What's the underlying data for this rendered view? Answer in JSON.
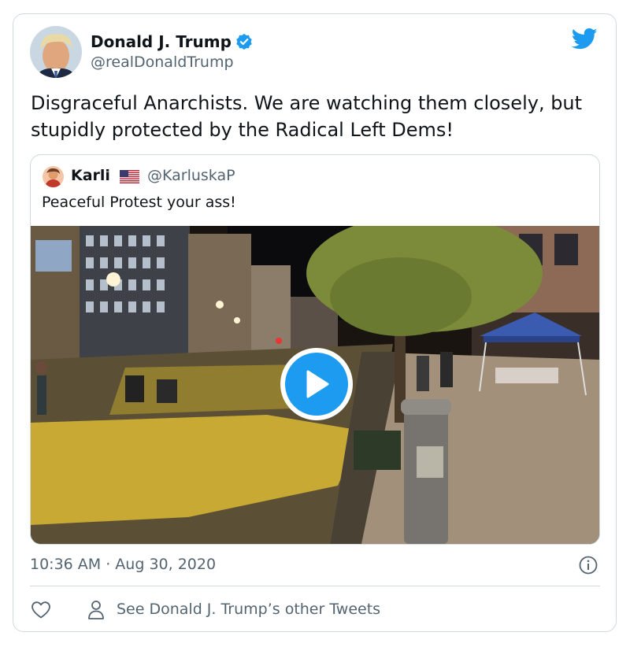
{
  "tweet": {
    "author_name": "Donald J. Trump",
    "author_handle": "@realDonaldTrump",
    "text": "Disgraceful Anarchists. We are watching them closely, but stupidly protected by the Radical Left Dems!",
    "timestamp": "10:36 AM · Aug 30, 2020",
    "other_tweets_link": "See Donald J. Trump’s other Tweets"
  },
  "quoted_tweet": {
    "author_name": "Karli",
    "author_handle": "@KarluskaP",
    "text": "Peaceful Protest your ass!",
    "media_type": "video"
  },
  "icons": {
    "verified": "verified-badge-icon",
    "brand": "twitter-bird-icon",
    "info": "info-icon",
    "like": "heart-icon",
    "profile": "person-icon",
    "play": "play-icon",
    "flag": "us-flag-icon"
  },
  "colors": {
    "accent": "#1d9bf0",
    "text": "#0f1419",
    "secondary_text": "#536471",
    "border": "#cfd9de"
  }
}
